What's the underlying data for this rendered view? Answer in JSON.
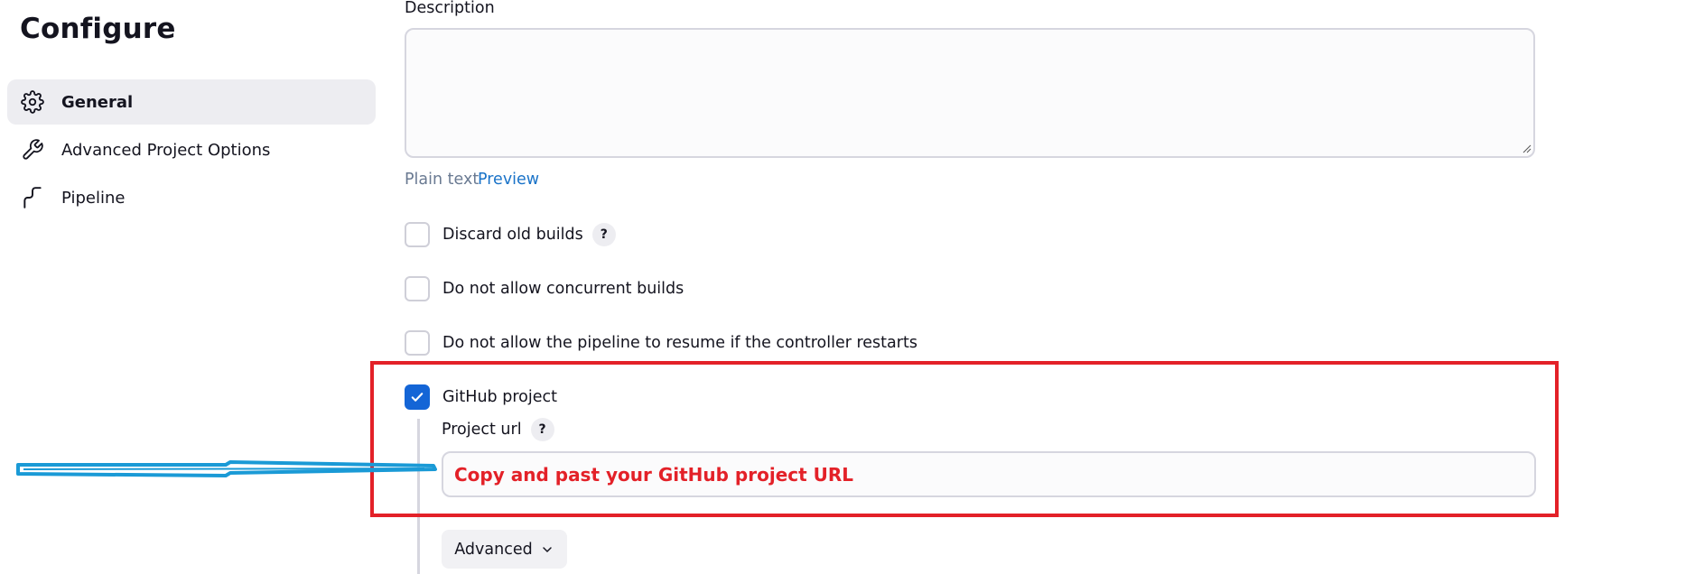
{
  "sidebar": {
    "title": "Configure",
    "items": [
      {
        "label": "General",
        "icon": "gear-icon",
        "active": true
      },
      {
        "label": "Advanced Project Options",
        "icon": "wrench-icon",
        "active": false
      },
      {
        "label": "Pipeline",
        "icon": "pipeline-icon",
        "active": false
      }
    ]
  },
  "main": {
    "description_label": "Description",
    "description_value": "",
    "format": {
      "plain": "Plain text",
      "preview": "Preview"
    },
    "options": [
      {
        "label": "Discard old builds",
        "checked": false,
        "help": "?"
      },
      {
        "label": "Do not allow concurrent builds",
        "checked": false
      },
      {
        "label": "Do not allow the pipeline to resume if the controller restarts",
        "checked": false
      },
      {
        "label": "GitHub project",
        "checked": true
      }
    ],
    "project_url": {
      "label": "Project url",
      "help": "?",
      "value": "Copy and past your GitHub project URL"
    },
    "advanced_button": "Advanced"
  },
  "colors": {
    "accent": "#1465d6",
    "annotation_box": "#e32128",
    "annotation_arrow": "#1a9ad6"
  }
}
